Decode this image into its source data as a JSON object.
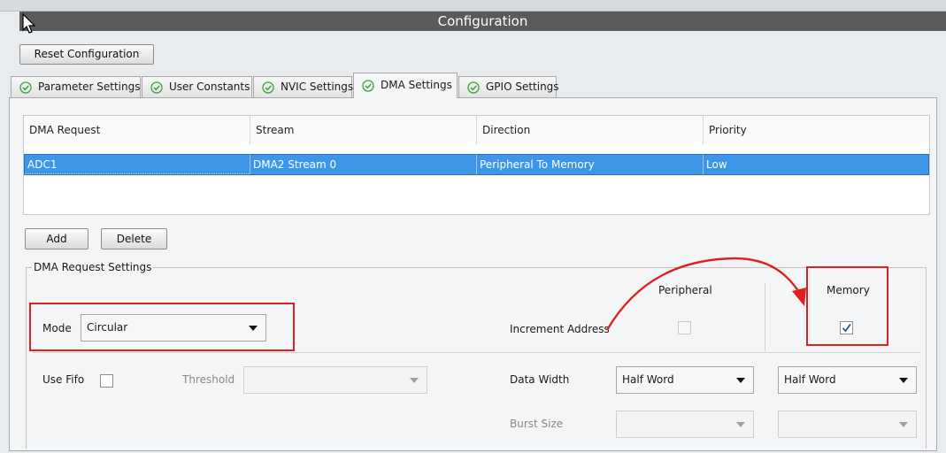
{
  "window": {
    "title": "Configuration"
  },
  "toolbar": {
    "reset_label": "Reset Configuration"
  },
  "tabs": [
    {
      "label": "Parameter Settings",
      "icon": "check-circle-icon"
    },
    {
      "label": "User Constants",
      "icon": "check-circle-icon"
    },
    {
      "label": "NVIC Settings",
      "icon": "check-circle-icon"
    },
    {
      "label": "DMA Settings",
      "icon": "check-circle-icon",
      "active": true
    },
    {
      "label": "GPIO Settings",
      "icon": "check-circle-icon"
    }
  ],
  "table": {
    "headers": [
      "DMA Request",
      "Stream",
      "Direction",
      "Priority"
    ],
    "rows": [
      {
        "request": "ADC1",
        "stream": "DMA2 Stream 0",
        "direction": "Peripheral To Memory",
        "priority": "Low",
        "selected": true
      }
    ]
  },
  "actions": {
    "add_label": "Add",
    "delete_label": "Delete"
  },
  "settings": {
    "group_label": "DMA Request Settings",
    "mode_label": "Mode",
    "mode_value": "Circular",
    "peripheral_header": "Peripheral",
    "memory_header": "Memory",
    "increment_label": "Increment Address",
    "peripheral_increment": false,
    "memory_increment": true,
    "use_fifo_label": "Use Fifo",
    "use_fifo": false,
    "threshold_label": "Threshold",
    "threshold_value": "",
    "data_width_label": "Data Width",
    "peripheral_data_width": "Half Word",
    "memory_data_width": "Half Word",
    "burst_size_label": "Burst Size",
    "peripheral_burst_size": "",
    "memory_burst_size": ""
  },
  "colors": {
    "selection": "#3d96e8",
    "annotation": "#e02020",
    "title_bar": "#5a5a5a"
  }
}
